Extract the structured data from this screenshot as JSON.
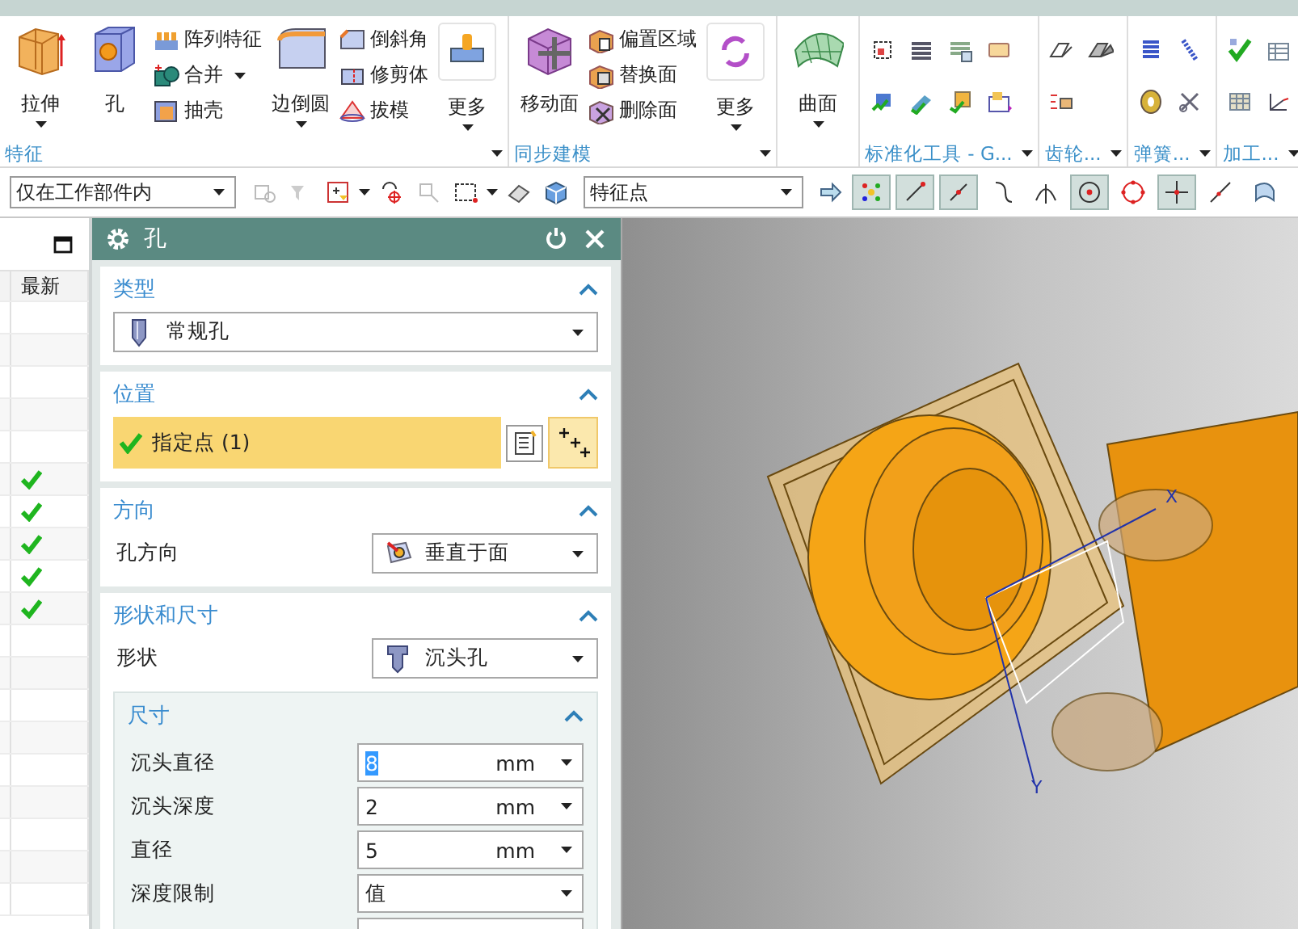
{
  "ribbon": {
    "groups": [
      {
        "label": "特征",
        "launcher": true,
        "items": [
          {
            "kind": "large",
            "label": "拉伸",
            "dropdown": true
          },
          {
            "kind": "large",
            "label": "孔",
            "dropdown": false
          },
          {
            "kind": "stack",
            "entries": [
              {
                "label": "阵列特征",
                "dropdown": false
              },
              {
                "label": "合并",
                "dropdown": true
              },
              {
                "label": "抽壳",
                "dropdown": false
              }
            ]
          },
          {
            "kind": "large",
            "label": "边倒圆",
            "dropdown": true
          },
          {
            "kind": "stack",
            "entries": [
              {
                "label": "倒斜角",
                "dropdown": false
              },
              {
                "label": "修剪体",
                "dropdown": false
              },
              {
                "label": "拔模",
                "dropdown": false
              }
            ]
          },
          {
            "kind": "more",
            "label": "更多",
            "dropdown": true
          }
        ]
      },
      {
        "label": "同步建模",
        "launcher": true,
        "items": [
          {
            "kind": "large",
            "label": "移动面",
            "dropdown": false
          },
          {
            "kind": "stack",
            "entries": [
              {
                "label": "偏置区域",
                "dropdown": false
              },
              {
                "label": "替换面",
                "dropdown": false
              },
              {
                "label": "删除面",
                "dropdown": false
              }
            ]
          },
          {
            "kind": "more",
            "label": "更多",
            "dropdown": true
          }
        ]
      },
      {
        "items": [
          {
            "kind": "large",
            "label": "曲面",
            "dropdown": true
          }
        ]
      },
      {
        "label": "标准化工具 - G...",
        "launcher": true,
        "items": [
          {
            "kind": "icon_grid"
          }
        ]
      },
      {
        "label": "齿轮...",
        "launcher": true,
        "items": [
          {
            "kind": "icon_grid"
          }
        ]
      },
      {
        "label": "弹簧...",
        "launcher": true,
        "items": [
          {
            "kind": "icon_grid"
          }
        ]
      },
      {
        "label": "加工...",
        "launcher": true,
        "items": [
          {
            "kind": "icon_grid"
          }
        ]
      }
    ]
  },
  "toolbar": {
    "filter": "仅在工作部件内",
    "snap_type": "特征点",
    "snap_points": [
      {
        "selected": true
      },
      {
        "selected": true
      },
      {
        "selected": true
      },
      {
        "selected": false
      },
      {
        "selected": false
      },
      {
        "selected": true
      },
      {
        "selected": false
      },
      {
        "selected": true
      },
      {
        "selected": false
      },
      {
        "selected": false
      }
    ]
  },
  "navigator": {
    "column": "最新",
    "rows": [
      {
        "up_to_date": false
      },
      {
        "up_to_date": false
      },
      {
        "up_to_date": false
      },
      {
        "up_to_date": false
      },
      {
        "up_to_date": false
      },
      {
        "up_to_date": true
      },
      {
        "up_to_date": true
      },
      {
        "up_to_date": true
      },
      {
        "up_to_date": true
      },
      {
        "up_to_date": true
      },
      {
        "up_to_date": false
      },
      {
        "up_to_date": false
      },
      {
        "up_to_date": false
      },
      {
        "up_to_date": false
      },
      {
        "up_to_date": false
      },
      {
        "up_to_date": false
      },
      {
        "up_to_date": false
      },
      {
        "up_to_date": false
      },
      {
        "up_to_date": false
      }
    ]
  },
  "dialog": {
    "title": "孔",
    "sections": [
      {
        "title": "类型",
        "expanded": true,
        "rows": [
          {
            "kind": "dropdown",
            "value": "常规孔"
          }
        ]
      },
      {
        "title": "位置",
        "expanded": true,
        "rows": [
          {
            "kind": "selection",
            "label": "指定点 (1)",
            "complete": true
          }
        ]
      },
      {
        "title": "方向",
        "expanded": true,
        "rows": [
          {
            "kind": "labeled_dropdown",
            "label": "孔方向",
            "value": "垂直于面"
          }
        ]
      },
      {
        "title": "形状和尺寸",
        "expanded": true,
        "rows": [
          {
            "kind": "labeled_dropdown",
            "label": "形状",
            "value": "沉头孔"
          },
          {
            "kind": "subsection",
            "title": "尺寸",
            "expanded": true,
            "rows": [
              {
                "kind": "number",
                "label": "沉头直径",
                "value": "8",
                "unit": "mm",
                "text_selected": true
              },
              {
                "kind": "number",
                "label": "沉头深度",
                "value": "2",
                "unit": "mm",
                "text_selected": false
              },
              {
                "kind": "number",
                "label": "直径",
                "value": "5",
                "unit": "mm",
                "text_selected": false
              },
              {
                "kind": "dropdown_field",
                "label": "深度限制",
                "value": "值"
              },
              {
                "kind": "blank_field"
              }
            ]
          }
        ]
      }
    ]
  },
  "view": {
    "axis_labels": [
      "X",
      "Y"
    ]
  }
}
